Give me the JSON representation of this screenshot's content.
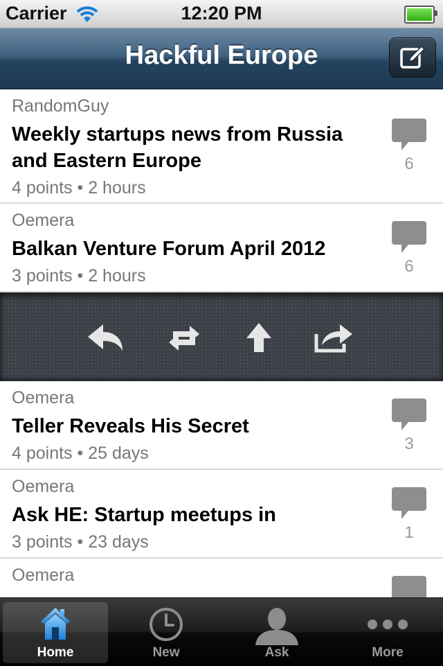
{
  "status_bar": {
    "carrier": "Carrier",
    "time": "12:20 PM"
  },
  "nav": {
    "title": "Hackful Europe",
    "compose_icon": "compose-icon"
  },
  "stories": [
    {
      "author": "RandomGuy",
      "title": "Weekly startups news from Russia and Eastern Europe",
      "meta": "4 points • 2 hours",
      "comments": "6"
    },
    {
      "author": "Oemera",
      "title": "Balkan Venture Forum April 2012",
      "meta": "3 points • 2 hours",
      "comments": "6"
    },
    {
      "author": "Oemera",
      "title": "Teller Reveals His Secret",
      "meta": "4 points • 25 days",
      "comments": "3"
    },
    {
      "author": "Oemera",
      "title": "Ask HE: Startup meetups in",
      "meta": "3 points • 23 days",
      "comments": "1"
    },
    {
      "author": "Oemera",
      "title": "",
      "meta": "",
      "comments": ""
    }
  ],
  "actions": [
    "reply-icon",
    "retweet-icon",
    "upvote-icon",
    "share-icon"
  ],
  "tabs": [
    {
      "label": "Home",
      "icon": "home-icon",
      "active": true
    },
    {
      "label": "New",
      "icon": "clock-icon",
      "active": false
    },
    {
      "label": "Ask",
      "icon": "person-icon",
      "active": false
    },
    {
      "label": "More",
      "icon": "more-icon",
      "active": false
    }
  ],
  "colors": {
    "nav_bar": "#2e4e6c",
    "tab_active_icon": "#4aa3ef",
    "comment_icon": "#8e8e8e"
  }
}
